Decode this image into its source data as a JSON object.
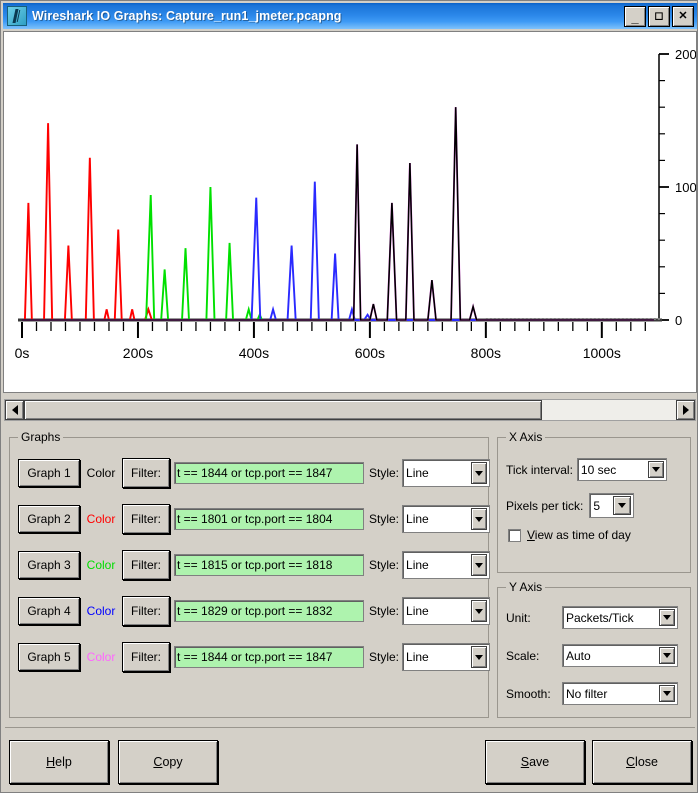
{
  "window": {
    "title": "Wireshark IO Graphs: Capture_run1_jmeter.pcapng",
    "icon": "wireshark-fin-icon",
    "minimize_label": "_",
    "maximize_label": "□",
    "close_label": "X"
  },
  "chart_data": {
    "type": "line",
    "title": "Wireshark IO Graph",
    "xlabel": "",
    "ylabel": "",
    "xlim": [
      0,
      1090
    ],
    "ylim": [
      0,
      200
    ],
    "x_tick_labels": [
      "0s",
      "200s",
      "400s",
      "600s",
      "800s",
      "1000s"
    ],
    "x_tick_values": [
      0,
      200,
      400,
      600,
      800,
      1000
    ],
    "x_minor_tick_step": 25,
    "y_tick_labels": [
      "0",
      "100",
      "200"
    ],
    "y_tick_values": [
      0,
      100,
      200
    ],
    "y_minor_tick_step": 20,
    "grid": false,
    "legend": "none",
    "unit": "Packets/Tick",
    "series": [
      {
        "name": "Graph 1",
        "color": "#000000",
        "style": "Line",
        "points": [
          [
            0,
            0
          ],
          [
            565,
            0
          ],
          [
            572,
            0
          ],
          [
            578,
            132
          ],
          [
            584,
            0
          ],
          [
            600,
            0
          ],
          [
            606,
            12
          ],
          [
            612,
            0
          ],
          [
            630,
            0
          ],
          [
            638,
            88
          ],
          [
            646,
            0
          ],
          [
            662,
            0
          ],
          [
            669,
            118
          ],
          [
            676,
            0
          ],
          [
            700,
            0
          ],
          [
            707,
            30
          ],
          [
            714,
            0
          ],
          [
            740,
            0
          ],
          [
            748,
            160
          ],
          [
            756,
            0
          ],
          [
            772,
            0
          ],
          [
            778,
            10
          ],
          [
            784,
            0
          ],
          [
            800,
            0
          ],
          [
            1090,
            0
          ]
        ]
      },
      {
        "name": "Graph 2",
        "color": "#ff0000",
        "style": "Line",
        "points": [
          [
            0,
            0
          ],
          [
            5,
            0
          ],
          [
            11,
            88
          ],
          [
            17,
            0
          ],
          [
            38,
            0
          ],
          [
            45,
            148
          ],
          [
            52,
            0
          ],
          [
            74,
            0
          ],
          [
            80,
            56
          ],
          [
            86,
            0
          ],
          [
            110,
            0
          ],
          [
            117,
            122
          ],
          [
            124,
            0
          ],
          [
            142,
            0
          ],
          [
            146,
            8
          ],
          [
            150,
            0
          ],
          [
            160,
            0
          ],
          [
            166,
            68
          ],
          [
            172,
            0
          ],
          [
            186,
            0
          ],
          [
            190,
            8
          ],
          [
            194,
            0
          ],
          [
            212,
            0
          ],
          [
            218,
            8
          ],
          [
            224,
            0
          ],
          [
            1090,
            0
          ]
        ]
      },
      {
        "name": "Graph 3",
        "color": "#00e000",
        "style": "Line",
        "points": [
          [
            0,
            0
          ],
          [
            214,
            0
          ],
          [
            222,
            94
          ],
          [
            228,
            0
          ],
          [
            240,
            0
          ],
          [
            246,
            38
          ],
          [
            252,
            0
          ],
          [
            276,
            0
          ],
          [
            282,
            54
          ],
          [
            288,
            0
          ],
          [
            318,
            0
          ],
          [
            325,
            100
          ],
          [
            332,
            0
          ],
          [
            352,
            0
          ],
          [
            358,
            58
          ],
          [
            364,
            0
          ],
          [
            386,
            0
          ],
          [
            391,
            8
          ],
          [
            396,
            0
          ],
          [
            406,
            0
          ],
          [
            410,
            4
          ],
          [
            414,
            0
          ],
          [
            1090,
            0
          ]
        ]
      },
      {
        "name": "Graph 4",
        "color": "#2a2aff",
        "style": "Line",
        "points": [
          [
            0,
            0
          ],
          [
            396,
            0
          ],
          [
            404,
            92
          ],
          [
            411,
            0
          ],
          [
            428,
            0
          ],
          [
            433,
            8
          ],
          [
            438,
            0
          ],
          [
            458,
            0
          ],
          [
            465,
            56
          ],
          [
            472,
            0
          ],
          [
            498,
            0
          ],
          [
            505,
            104
          ],
          [
            512,
            0
          ],
          [
            534,
            0
          ],
          [
            540,
            50
          ],
          [
            546,
            0
          ],
          [
            564,
            0
          ],
          [
            569,
            8
          ],
          [
            574,
            0
          ],
          [
            590,
            0
          ],
          [
            596,
            4
          ],
          [
            602,
            0
          ],
          [
            1090,
            0
          ]
        ]
      },
      {
        "name": "Graph 5",
        "color": "#ff66ff",
        "style": "Line",
        "points": [
          [
            0,
            0
          ],
          [
            565,
            0
          ],
          [
            572,
            0
          ],
          [
            578,
            132
          ],
          [
            584,
            0
          ],
          [
            600,
            0
          ],
          [
            606,
            12
          ],
          [
            612,
            0
          ],
          [
            630,
            0
          ],
          [
            638,
            88
          ],
          [
            646,
            0
          ],
          [
            662,
            0
          ],
          [
            669,
            118
          ],
          [
            676,
            0
          ],
          [
            700,
            0
          ],
          [
            707,
            30
          ],
          [
            714,
            0
          ],
          [
            740,
            0
          ],
          [
            748,
            160
          ],
          [
            756,
            0
          ],
          [
            772,
            0
          ],
          [
            778,
            10
          ],
          [
            784,
            0
          ],
          [
            1090,
            0
          ]
        ]
      }
    ]
  },
  "scrollbar": {
    "left_arrow": "scroll-left",
    "right_arrow": "scroll-right",
    "thumb_position_percent": 0,
    "thumb_width_percent": 79.5
  },
  "graphs_panel": {
    "legend": "Graphs",
    "color_label": "Color",
    "filter_label": "Filter:",
    "style_label": "Style:",
    "rows": [
      {
        "button": "Graph 1",
        "color": "#000000",
        "filter": "t == 1844 or tcp.port == 1847",
        "style": "Line"
      },
      {
        "button": "Graph 2",
        "color": "#ff0000",
        "filter": "t == 1801 or tcp.port == 1804",
        "style": "Line"
      },
      {
        "button": "Graph 3",
        "color": "#00dd00",
        "filter": "t == 1815 or tcp.port == 1818",
        "style": "Line"
      },
      {
        "button": "Graph 4",
        "color": "#0000ff",
        "filter": "t == 1829 or tcp.port == 1832",
        "style": "Line"
      },
      {
        "button": "Graph 5",
        "color": "#ff66ff",
        "filter": "t == 1844 or tcp.port == 1847",
        "style": "Line"
      }
    ]
  },
  "x_axis_panel": {
    "legend": "X Axis",
    "tick_interval_label": "Tick interval:",
    "tick_interval_value": "10 sec",
    "pixels_per_tick_label": "Pixels per tick:",
    "pixels_per_tick_value": "5",
    "time_of_day_label_pre": "V",
    "time_of_day_label_post": "iew as time of day",
    "time_of_day_checked": false
  },
  "y_axis_panel": {
    "legend": "Y Axis",
    "unit_label": "Unit:",
    "unit_value": "Packets/Tick",
    "scale_label": "Scale:",
    "scale_value": "Auto",
    "smooth_label": "Smooth:",
    "smooth_value": "No filter"
  },
  "footer": {
    "help_pre": "H",
    "help_post": "elp",
    "copy_pre": "C",
    "copy_post": "opy",
    "save_pre": "S",
    "save_post": "ave",
    "close_pre": "C",
    "close_post": "lose"
  }
}
